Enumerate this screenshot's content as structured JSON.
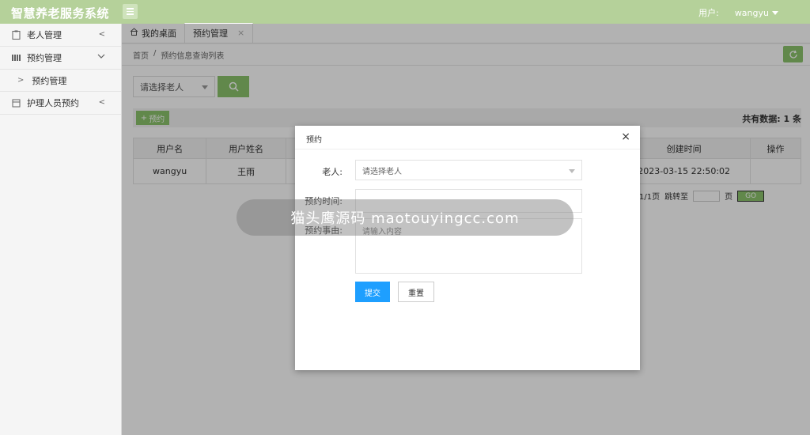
{
  "header": {
    "app_title": "智慧养老服务系统",
    "user_label": "用户:",
    "user_name": "wangyu"
  },
  "sidebar": {
    "items": [
      {
        "label": "老人管理",
        "icon": "clipboard-icon"
      },
      {
        "label": "预约管理",
        "icon": "grid-icon"
      },
      {
        "label": "预约管理",
        "icon": "arrow-right-icon"
      },
      {
        "label": "护理人员预约",
        "icon": "calendar-icon"
      }
    ]
  },
  "tabs": [
    {
      "label": "我的桌面"
    },
    {
      "label": "预约管理",
      "close": "×"
    }
  ],
  "breadcrumb": {
    "home": "首页",
    "sep": "/",
    "current": "预约信息查询列表"
  },
  "search": {
    "placeholder": "请选择老人"
  },
  "toolbar": {
    "add_label": "预约",
    "total_label": "共有数据:",
    "total_value": "1",
    "total_unit": "条"
  },
  "table": {
    "headers": [
      "用户名",
      "用户姓名",
      "",
      "",
      "创建时间",
      "操作"
    ],
    "rows": [
      [
        "wangyu",
        "王雨",
        "",
        "",
        "2023-03-15 22:50:02",
        ""
      ]
    ]
  },
  "pager": {
    "info": "1/1页",
    "jump_label": "跳转至",
    "page_label": "页",
    "go": "GO"
  },
  "modal": {
    "title": "预约",
    "close": "×",
    "elder_label": "老人:",
    "elder_placeholder": "请选择老人",
    "time_label": "预约时间:",
    "reason_label": "预约事由:",
    "reason_placeholder": "请输入内容",
    "submit": "提交",
    "reset": "重置"
  },
  "loading": {
    "text": "猫头鹰源码 maotouyingcc.com"
  },
  "colors": {
    "header": "#b5d19a",
    "primary": "#8bc36c",
    "submit": "#1e9fff"
  }
}
